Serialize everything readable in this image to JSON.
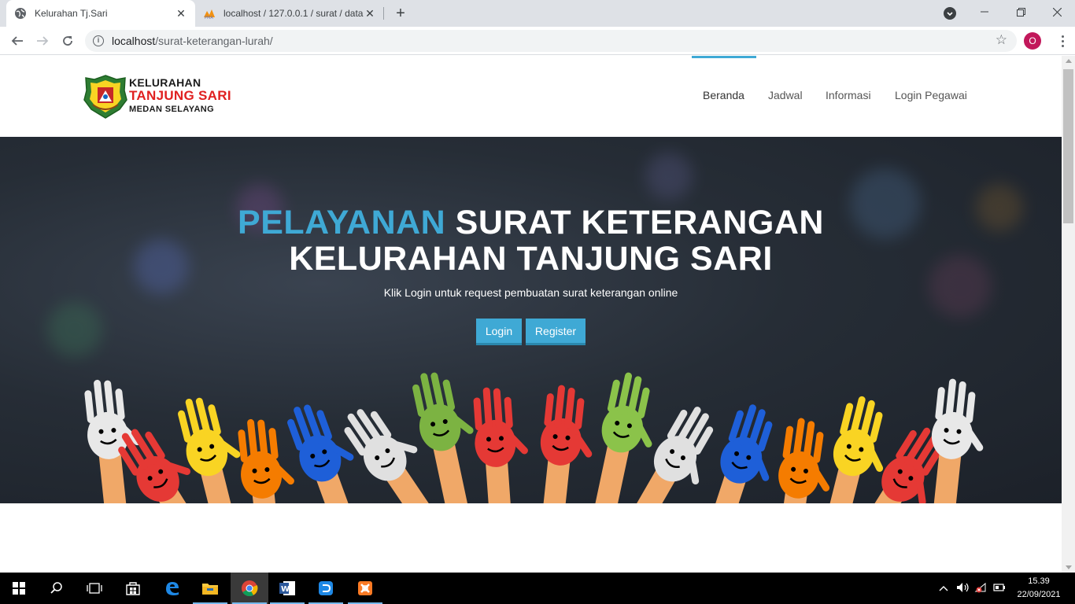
{
  "browser": {
    "tabs": [
      {
        "title": "Kelurahan Tj.Sari",
        "active": true,
        "icon": "globe-icon"
      },
      {
        "title": "localhost / 127.0.0.1 / surat / data",
        "active": false,
        "icon": "phpmyadmin-icon"
      }
    ],
    "new_tab_label": "+",
    "url_host": "localhost",
    "url_path": "/surat-keterangan-lurah/",
    "profile_initial": "O"
  },
  "site": {
    "logo": {
      "line1": "KELURAHAN",
      "line2": "TANJUNG SARI",
      "line3": "MEDAN SELAYANG"
    },
    "nav": [
      {
        "label": "Beranda",
        "active": true
      },
      {
        "label": "Jadwal",
        "active": false
      },
      {
        "label": "Informasi",
        "active": false
      },
      {
        "label": "Login Pegawai",
        "active": false
      }
    ],
    "hero": {
      "title_accent": "PELAYANAN",
      "title_rest": " SURAT KETERANGAN",
      "title_line2": "KELURAHAN TANJUNG SARI",
      "subtitle": "Klik Login untuk request pembuatan surat keterangan online",
      "login_label": "Login",
      "register_label": "Register"
    },
    "colors": {
      "accent": "#3fa9d5",
      "logo_red": "#e02020",
      "hero_bg": "#262d36"
    }
  },
  "taskbar": {
    "apps": [
      "windows-start-icon",
      "search-icon",
      "task-view-icon",
      "store-icon",
      "edge-icon",
      "file-explorer-icon",
      "chrome-icon",
      "word-icon",
      "pdf-editor-icon",
      "xampp-icon"
    ],
    "time": "15.39",
    "date": "22/09/2021"
  }
}
